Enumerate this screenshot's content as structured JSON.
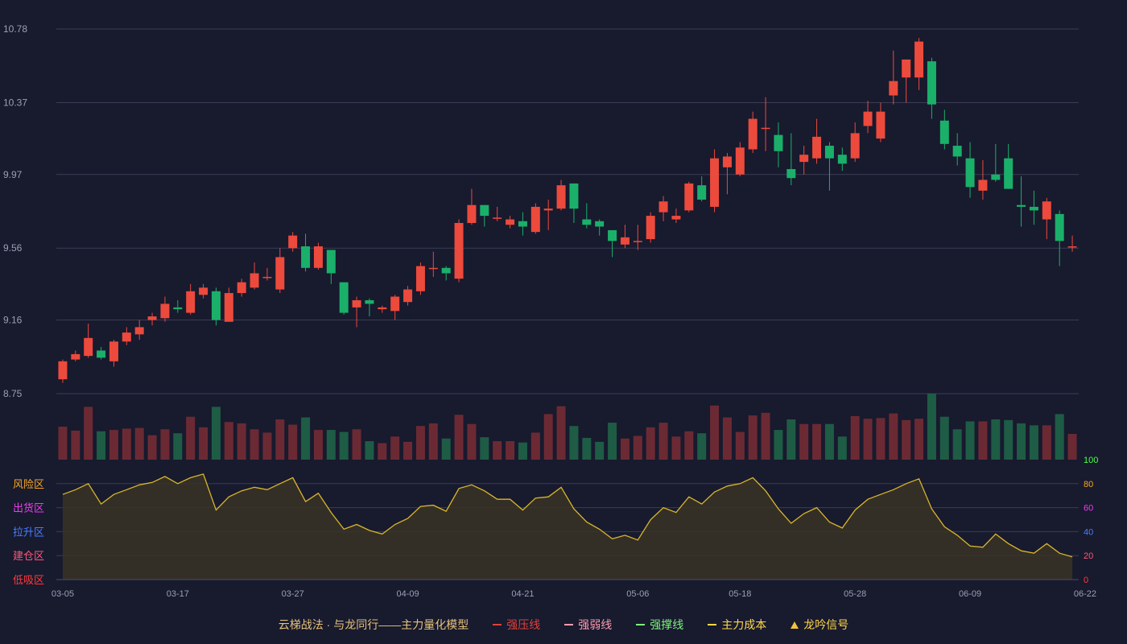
{
  "chart_data": {
    "type": "candlestick",
    "price_axis": {
      "ticks": [
        "10.78",
        "10.37",
        "9.97",
        "9.56",
        "9.16",
        "8.75"
      ],
      "ylim": [
        8.75,
        10.78
      ],
      "grid": true
    },
    "dates": [
      "03-05",
      "03-17",
      "03-27",
      "04-09",
      "04-21",
      "05-06",
      "05-18",
      "05-28",
      "06-09",
      "06-22"
    ],
    "candles": [
      [
        8.83,
        8.93,
        8.81,
        8.94
      ],
      [
        8.94,
        8.97,
        8.93,
        8.99
      ],
      [
        8.96,
        9.06,
        8.95,
        9.14
      ],
      [
        8.99,
        8.95,
        8.94,
        9.01
      ],
      [
        8.93,
        9.04,
        8.9,
        9.05
      ],
      [
        9.04,
        9.09,
        9.02,
        9.12
      ],
      [
        9.08,
        9.12,
        9.05,
        9.16
      ],
      [
        9.16,
        9.18,
        9.13,
        9.2
      ],
      [
        9.17,
        9.25,
        9.15,
        9.29
      ],
      [
        9.23,
        9.22,
        9.2,
        9.27
      ],
      [
        9.2,
        9.32,
        9.19,
        9.36
      ],
      [
        9.3,
        9.34,
        9.28,
        9.36
      ],
      [
        9.32,
        9.16,
        9.13,
        9.34
      ],
      [
        9.15,
        9.31,
        9.15,
        9.34
      ],
      [
        9.31,
        9.37,
        9.29,
        9.39
      ],
      [
        9.34,
        9.42,
        9.33,
        9.48
      ],
      [
        9.4,
        9.4,
        9.38,
        9.45
      ],
      [
        9.33,
        9.51,
        9.31,
        9.56
      ],
      [
        9.56,
        9.63,
        9.54,
        9.65
      ],
      [
        9.57,
        9.45,
        9.43,
        9.64
      ],
      [
        9.45,
        9.57,
        9.44,
        9.59
      ],
      [
        9.55,
        9.42,
        9.36,
        9.55
      ],
      [
        9.37,
        9.2,
        9.19,
        9.37
      ],
      [
        9.23,
        9.27,
        9.12,
        9.29
      ],
      [
        9.27,
        9.25,
        9.18,
        9.28
      ],
      [
        9.22,
        9.23,
        9.2,
        9.24
      ],
      [
        9.21,
        9.29,
        9.16,
        9.3
      ],
      [
        9.26,
        9.33,
        9.24,
        9.35
      ],
      [
        9.32,
        9.46,
        9.3,
        9.48
      ],
      [
        9.45,
        9.45,
        9.4,
        9.54
      ],
      [
        9.45,
        9.42,
        9.38,
        9.46
      ],
      [
        9.39,
        9.7,
        9.37,
        9.72
      ],
      [
        9.7,
        9.8,
        9.69,
        9.89
      ],
      [
        9.8,
        9.74,
        9.68,
        9.8
      ],
      [
        9.73,
        9.73,
        9.71,
        9.79
      ],
      [
        9.69,
        9.72,
        9.67,
        9.74
      ],
      [
        9.71,
        9.68,
        9.63,
        9.76
      ],
      [
        9.65,
        9.79,
        9.64,
        9.81
      ],
      [
        9.77,
        9.78,
        9.66,
        9.83
      ],
      [
        9.78,
        9.91,
        9.77,
        9.94
      ],
      [
        9.92,
        9.78,
        9.7,
        9.92
      ],
      [
        9.72,
        9.69,
        9.67,
        9.81
      ],
      [
        9.71,
        9.68,
        9.63,
        9.72
      ],
      [
        9.66,
        9.6,
        9.51,
        9.66
      ],
      [
        9.58,
        9.62,
        9.56,
        9.69
      ],
      [
        9.6,
        9.6,
        9.55,
        9.69
      ],
      [
        9.61,
        9.74,
        9.59,
        9.76
      ],
      [
        9.76,
        9.82,
        9.71,
        9.85
      ],
      [
        9.72,
        9.74,
        9.7,
        9.78
      ],
      [
        9.77,
        9.92,
        9.76,
        9.93
      ],
      [
        9.91,
        9.83,
        9.82,
        9.96
      ],
      [
        9.79,
        10.06,
        9.76,
        10.11
      ],
      [
        10.01,
        10.07,
        9.86,
        10.09
      ],
      [
        9.97,
        10.12,
        9.96,
        10.15
      ],
      [
        10.11,
        10.28,
        10.09,
        10.32
      ],
      [
        10.23,
        10.23,
        10.1,
        10.4
      ],
      [
        10.19,
        10.1,
        10.01,
        10.26
      ],
      [
        10.0,
        9.95,
        9.91,
        10.2
      ],
      [
        10.04,
        10.08,
        9.97,
        10.13
      ],
      [
        10.06,
        10.18,
        10.03,
        10.28
      ],
      [
        10.13,
        10.06,
        9.88,
        10.15
      ],
      [
        10.08,
        10.03,
        9.99,
        10.12
      ],
      [
        10.06,
        10.2,
        10.04,
        10.26
      ],
      [
        10.24,
        10.32,
        10.2,
        10.38
      ],
      [
        10.17,
        10.32,
        10.15,
        10.37
      ],
      [
        10.41,
        10.49,
        10.36,
        10.66
      ],
      [
        10.51,
        10.61,
        10.37,
        10.61
      ],
      [
        10.51,
        10.71,
        10.44,
        10.73
      ],
      [
        10.6,
        10.36,
        10.28,
        10.62
      ],
      [
        10.27,
        10.14,
        10.11,
        10.33
      ],
      [
        10.13,
        10.07,
        10.02,
        10.2
      ],
      [
        10.06,
        9.9,
        9.84,
        10.15
      ],
      [
        9.88,
        9.94,
        9.83,
        10.05
      ],
      [
        9.97,
        9.94,
        9.93,
        10.14
      ],
      [
        10.06,
        9.89,
        9.89,
        10.14
      ],
      [
        9.8,
        9.79,
        9.68,
        9.96
      ],
      [
        9.79,
        9.77,
        9.69,
        9.88
      ],
      [
        9.72,
        9.82,
        9.61,
        9.84
      ],
      [
        9.75,
        9.6,
        9.46,
        9.77
      ],
      [
        9.57,
        9.57,
        9.54,
        9.63
      ]
    ],
    "volumes": [
      0.5,
      0.44,
      0.8,
      0.43,
      0.45,
      0.47,
      0.48,
      0.37,
      0.46,
      0.4,
      0.65,
      0.49,
      0.8,
      0.57,
      0.55,
      0.46,
      0.41,
      0.61,
      0.53,
      0.64,
      0.45,
      0.45,
      0.42,
      0.46,
      0.28,
      0.25,
      0.35,
      0.27,
      0.51,
      0.55,
      0.32,
      0.68,
      0.54,
      0.34,
      0.28,
      0.28,
      0.26,
      0.41,
      0.69,
      0.81,
      0.51,
      0.33,
      0.27,
      0.56,
      0.32,
      0.36,
      0.49,
      0.56,
      0.35,
      0.43,
      0.4,
      0.82,
      0.64,
      0.42,
      0.67,
      0.71,
      0.45,
      0.61,
      0.54,
      0.54,
      0.54,
      0.35,
      0.66,
      0.62,
      0.63,
      0.7,
      0.6,
      0.62,
      1.0,
      0.65,
      0.46,
      0.58,
      0.58,
      0.61,
      0.6,
      0.55,
      0.52,
      0.52,
      0.69,
      0.39
    ],
    "oscillator": {
      "yticks": [
        "100",
        "80",
        "60",
        "40",
        "20",
        "0"
      ],
      "zones": [
        "风险区",
        "出货区",
        "拉升区",
        "建仓区",
        "低吸区"
      ],
      "ylim": [
        0,
        100
      ],
      "values": [
        71,
        75,
        80,
        63,
        71,
        75,
        79,
        81,
        86,
        80,
        85,
        88,
        58,
        69,
        74,
        77,
        75,
        80,
        85,
        65,
        72,
        56,
        42,
        46,
        41,
        38,
        46,
        51,
        61,
        62,
        57,
        76,
        79,
        74,
        67,
        67,
        58,
        68,
        69,
        77,
        59,
        48,
        42,
        34,
        37,
        33,
        50,
        60,
        56,
        69,
        63,
        73,
        78,
        80,
        85,
        74,
        59,
        47,
        55,
        60,
        48,
        43,
        58,
        67,
        71,
        75,
        80,
        84,
        59,
        44,
        37,
        28,
        27,
        38,
        30,
        24,
        22,
        30,
        22,
        19
      ],
      "line_color": "#d9b62a"
    },
    "legend": [
      {
        "label": "强压线",
        "color": "#e0403a",
        "style": "solid"
      },
      {
        "label": "强弱线",
        "color": "#ff9ab0",
        "style": "dashed"
      },
      {
        "label": "强撑线",
        "color": "#7cf07c",
        "style": "solid"
      },
      {
        "label": "主力成本",
        "color": "#ffd84a",
        "style": "dashed"
      },
      {
        "label": "龙吟信号",
        "color": "#f3c33b",
        "style": "triangle"
      }
    ],
    "legend_title": "云梯战法 · 与龙同行——主力量化模型",
    "colors": {
      "up": "#ec4a3c",
      "down": "#1ab06a",
      "vol_up": "#6b2a33",
      "vol_down": "#1e5c45",
      "axis_text": "#9aa0b5"
    }
  }
}
